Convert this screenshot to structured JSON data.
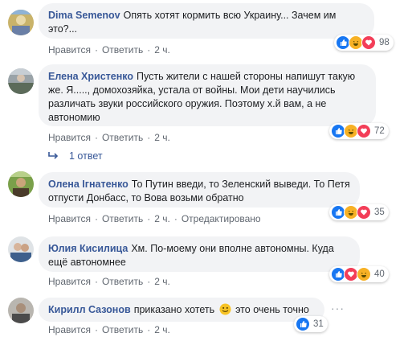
{
  "comments": [
    {
      "author": "Dima Semenov",
      "text": "Опять хотят кормить всю Украину... Зачем им это?...",
      "reactions": {
        "count": "98",
        "icons": [
          "like-icon",
          "haha-icon",
          "love-icon"
        ]
      },
      "actions": {
        "like": "Нравится",
        "reply": "Ответить",
        "time": "2 ч."
      }
    },
    {
      "author": "Елена Христенко",
      "text": "Пусть жители с нашей стороны напишут такую же. Я....., домохозяйка, устала от войны. Мои дети научились различать звуки российского оружия. Поэтому х.й вам, а не автономию",
      "reactions": {
        "count": "72",
        "icons": [
          "like-icon",
          "haha-icon",
          "love-icon"
        ]
      },
      "actions": {
        "like": "Нравится",
        "reply": "Ответить",
        "time": "2 ч."
      },
      "replies": "1 ответ"
    },
    {
      "author": "Олена Ігнатенко",
      "text": "То Путин введи, то Зеленский выведи. То Петя отпусти Донбасс, то Вова возьми обратно",
      "reactions": {
        "count": "35",
        "icons": [
          "like-icon",
          "haha-icon",
          "love-icon"
        ]
      },
      "actions": {
        "like": "Нравится",
        "reply": "Ответить",
        "time": "2 ч.",
        "edited": "Отредактировано"
      }
    },
    {
      "author": "Юлия Кисилица",
      "text": "Хм. По-моему они вполне автономны. Куда ещё автономнее",
      "reactions": {
        "count": "40",
        "icons": [
          "like-icon",
          "love-icon",
          "haha-icon"
        ]
      },
      "actions": {
        "like": "Нравится",
        "reply": "Ответить",
        "time": "2 ч."
      }
    },
    {
      "author": "Кирилл Сазонов",
      "text_before": "приказано хотеть",
      "text_after": "это очень точно",
      "emoji": "smile-emoji",
      "reactions": {
        "count": "31",
        "icons": [
          "like-icon"
        ]
      },
      "actions": {
        "like": "Нравится",
        "reply": "Ответить",
        "time": "2 ч."
      }
    }
  ],
  "colors": {
    "author": "#385898",
    "bubble": "#f2f3f5",
    "meta": "#606770",
    "like": "#1877f2",
    "haha": "#f7b125",
    "love": "#f33e58"
  }
}
